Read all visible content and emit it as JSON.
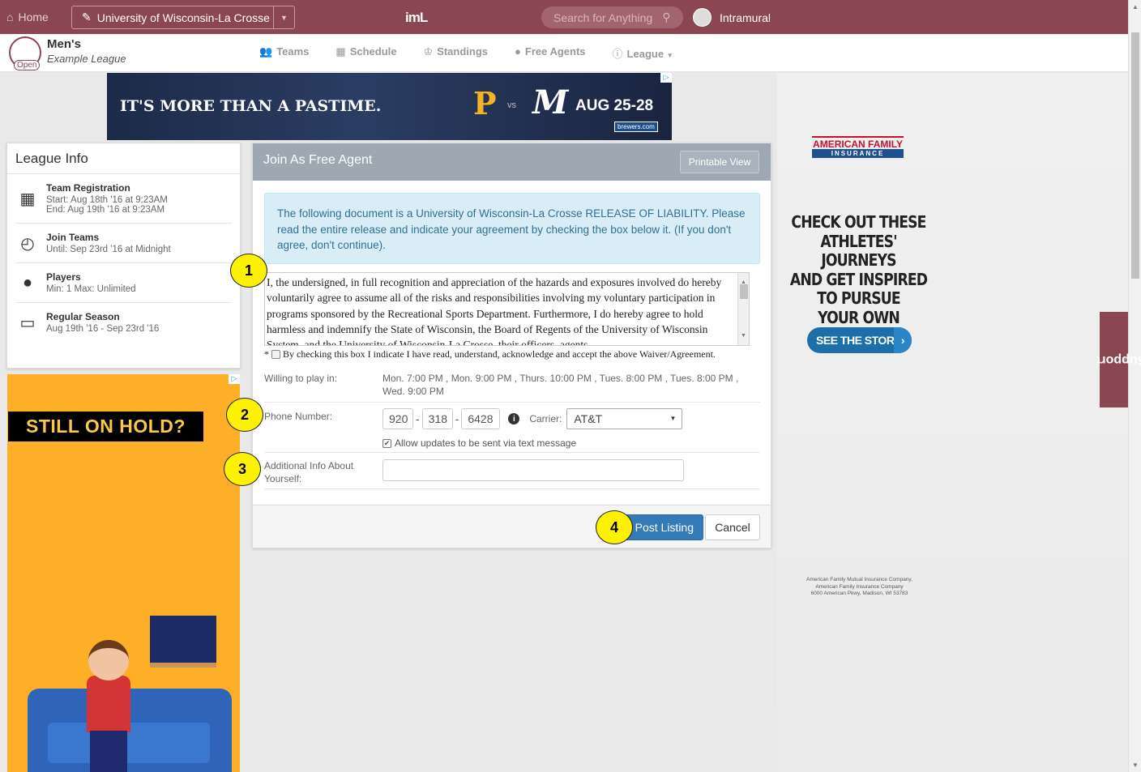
{
  "topbar": {
    "home_label": "Home",
    "school_name": "University of Wisconsin-La Crosse",
    "logo_text": "imL",
    "search_placeholder": "Search for Anything",
    "org_name": "Intramural"
  },
  "league": {
    "name": "Men's",
    "subtitle": "Example League",
    "status_badge": "Open",
    "nav": [
      {
        "label": "Teams",
        "icon": "users-icon"
      },
      {
        "label": "Schedule",
        "icon": "calendar-icon"
      },
      {
        "label": "Standings",
        "icon": "trophy-icon"
      },
      {
        "label": "Free Agents",
        "icon": "user-icon"
      },
      {
        "label": "League",
        "icon": "info-icon"
      }
    ]
  },
  "top_ad": {
    "tagline": "IT'S MORE THAN A PASTIME.",
    "team_left": "P",
    "vs": "vs",
    "team_right": "M",
    "dates": "AUG 25-28",
    "url": "brewers.com"
  },
  "league_info": {
    "title": "League Info",
    "items": [
      {
        "icon": "calendar-grid-icon",
        "title": "Team Registration",
        "line1": "Start: Aug 18th '16 at 9:23AM",
        "line2": "End: Aug 19th '16 at 9:23AM"
      },
      {
        "icon": "clock-icon",
        "title": "Join Teams",
        "line1": "Until: Sep 23rd '16 at Midnight",
        "line2": ""
      },
      {
        "icon": "person-icon",
        "title": "Players",
        "line1": "Min: 1 Max: Unlimited",
        "line2": ""
      },
      {
        "icon": "calendar-icon",
        "title": "Regular Season",
        "line1": "Aug 19th '16 - Sep 23rd '16",
        "line2": ""
      }
    ]
  },
  "left_ad": {
    "headline": "STILL ON HOLD?"
  },
  "form": {
    "title": "Join As Free Agent",
    "printable_label": "Printable View",
    "alert_text": "The following document is a University of Wisconsin-La Crosse RELEASE OF LIABILITY. Please read the entire release and indicate your agreement by checking the box below it. (If you don't agree, don't continue).",
    "waiver_text": "I, the undersigned, in full recognition and appreciation of the hazards and exposures involved do hereby voluntarily agree to assume all of the risks and responsibilities involving my voluntary participation in programs sponsored by the Recreational Sports Department.  Furthermore, I do hereby agree to hold harmless and indemnify the State of Wisconsin, the Board of Regents of the University of Wisconsin System, and the University of Wisconsin-La Crosse, their officers, agents",
    "agree_label": "By checking this box I indicate I have read, understand, acknowledge and accept the above Waiver/Agreement.",
    "required_mark": "*",
    "willing_label": "Willing to play in:",
    "willing_value": "Mon. 7:00 PM , Mon. 9:00 PM , Thurs. 10:00 PM , Tues. 8:00 PM , Tues. 8:00 PM , Wed. 9:00 PM",
    "phone_label": "Phone Number:",
    "phone_area": "920",
    "phone_prefix": "318",
    "phone_line": "6428",
    "phone_sep": "-",
    "carrier_label": "Carrier:",
    "carrier_value": "AT&T",
    "sms_label": "Allow updates to be sent via text message",
    "additional_label": "Additional Info About Yourself:",
    "additional_value": "",
    "post_label": "Post Listing",
    "cancel_label": "Cancel"
  },
  "markers": [
    "1",
    "2",
    "3",
    "4"
  ],
  "right_ad": {
    "brand": "AMERICAN FAMILY",
    "brand_sub": "INSURANCE",
    "headline_lines": [
      "CHECK OUT THESE",
      "ATHLETES' JOURNEYS",
      "AND GET INSPIRED",
      "TO PURSUE",
      "YOUR OWN DREAM."
    ],
    "cta": "SEE THE STORIES",
    "fine_lines": [
      "American Family Mutual Insurance Company,",
      "American Family Insurance Company",
      "6000 American Pkwy, Madison, WI 53783"
    ]
  },
  "support_label": "Support",
  "colors": {
    "brand": "#8a4651",
    "primary": "#337ab7",
    "alert_bg": "#d9edf7",
    "marker": "#fff200"
  }
}
